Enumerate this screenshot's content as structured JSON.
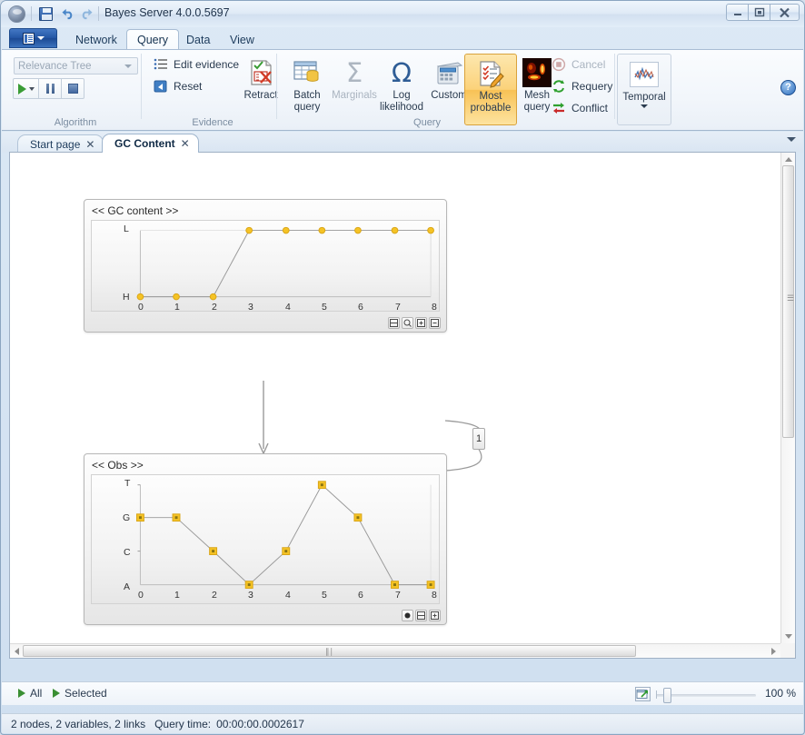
{
  "window": {
    "title": "Bayes Server 4.0.0.5697",
    "quick_access": [
      "save-icon",
      "undo-icon",
      "redo-icon"
    ],
    "buttons": {
      "minimize": "–",
      "maximize": "▣",
      "close": "✕"
    }
  },
  "ribbon": {
    "app_button": "application-menu",
    "tabs": [
      {
        "label": "Network",
        "active": false
      },
      {
        "label": "Query",
        "active": true
      },
      {
        "label": "Data",
        "active": false
      },
      {
        "label": "View",
        "active": false
      }
    ],
    "help_label": "?",
    "groups": [
      {
        "name": "Algorithm",
        "label": "Algorithm",
        "combo_value": "Relevance Tree",
        "buttons": [
          "run-button",
          "run-dropdown",
          "pause-button",
          "stop-button"
        ]
      },
      {
        "name": "Evidence",
        "label": "Evidence",
        "items": [
          {
            "label": "Edit evidence",
            "icon": "edit-evidence-icon"
          },
          {
            "label": "Reset",
            "icon": "reset-icon"
          }
        ],
        "big": [
          {
            "label": "Retract",
            "icon": "retract-icon"
          }
        ]
      },
      {
        "name": "Query",
        "label": "Query",
        "big": [
          {
            "label": "Batch query",
            "icon": "batch-query-icon",
            "disabled": false,
            "selected": false
          },
          {
            "label": "Marginals",
            "icon": "sigma-icon",
            "disabled": true,
            "selected": false
          },
          {
            "label": "Log likelihood",
            "icon": "omega-icon",
            "disabled": false,
            "selected": false
          },
          {
            "label": "Custom",
            "icon": "calculator-icon",
            "disabled": false,
            "selected": false
          },
          {
            "label": "Most probable",
            "icon": "most-probable-icon",
            "disabled": false,
            "selected": true
          },
          {
            "label": "Mesh query",
            "icon": "mesh-query-icon",
            "disabled": false,
            "selected": false
          }
        ],
        "small": [
          {
            "label": "Cancel",
            "icon": "cancel-icon",
            "disabled": true
          },
          {
            "label": "Requery",
            "icon": "requery-icon",
            "disabled": false
          },
          {
            "label": "Conflict",
            "icon": "conflict-icon",
            "disabled": false
          }
        ]
      },
      {
        "name": "Temporal",
        "label": "",
        "big": [
          {
            "label": "Temporal",
            "icon": "temporal-icon",
            "has_dropdown": true
          }
        ]
      }
    ]
  },
  "doctabs": {
    "tabs": [
      {
        "label": "Start page",
        "close": "✕",
        "active": false
      },
      {
        "label": "GC Content",
        "close": "✕",
        "active": true
      }
    ],
    "overflow": "chevron-down-icon"
  },
  "canvas": {
    "nodes": [
      {
        "id": "gc-content",
        "title": "<< GC content >>",
        "buttons": [
          "table-view-icon",
          "zoom-icon",
          "plus-icon",
          "minus-icon"
        ],
        "self_link_label": "1"
      },
      {
        "id": "obs",
        "title": "<< Obs >>",
        "buttons": [
          "dot-icon",
          "table-view-icon",
          "plus-icon"
        ]
      }
    ],
    "link": "gc-content-to-obs"
  },
  "chart_data": [
    {
      "type": "line",
      "title": "<< GC content >>",
      "x": [
        0,
        1,
        2,
        3,
        4,
        5,
        6,
        7,
        8
      ],
      "xlabel": "",
      "ylabel": "",
      "categories_y": [
        "H",
        "L"
      ],
      "ytick_labels": [
        "H",
        "L"
      ],
      "values": [
        "H",
        "H",
        "H",
        "L",
        "L",
        "L",
        "L",
        "L",
        "L"
      ],
      "values_index": [
        0,
        0,
        0,
        1,
        1,
        1,
        1,
        1,
        1
      ],
      "ylim": [
        0,
        1
      ],
      "grid": false,
      "marker": "circle",
      "marker_color": "#f5c325",
      "line_color": "#9a9a9a",
      "legend": null
    },
    {
      "type": "line",
      "title": "<< Obs >>",
      "x": [
        0,
        1,
        2,
        3,
        4,
        5,
        6,
        7,
        8
      ],
      "xlabel": "",
      "ylabel": "",
      "categories_y": [
        "A",
        "C",
        "G",
        "T"
      ],
      "ytick_labels": [
        "A",
        "C",
        "G",
        "T"
      ],
      "values": [
        "G",
        "G",
        "C",
        "A",
        "C",
        "T",
        "G",
        "A",
        "A"
      ],
      "values_index": [
        2,
        2,
        1,
        0,
        1,
        3,
        2,
        0,
        0
      ],
      "ylim": [
        0,
        3
      ],
      "grid": false,
      "marker": "square",
      "marker_color": "#f5c325",
      "line_color": "#9a9a9a",
      "legend": null
    }
  ],
  "bottom_toolbar": {
    "items": [
      {
        "label": "All",
        "icon": "run-all-icon"
      },
      {
        "label": "Selected",
        "icon": "run-selected-icon"
      }
    ],
    "fit_icon": "fit-to-window-icon",
    "zoom_value": "100 %"
  },
  "statusbar": {
    "counts": "2 nodes, 2 variables, 2 links",
    "query_time_label": "Query time:",
    "query_time_value": "00:00:00.0002617"
  },
  "colors": {
    "accent": "#2457a5",
    "selected_button": "#f8c256",
    "marker": "#f5c325",
    "node_border": "#b7b7b7"
  }
}
